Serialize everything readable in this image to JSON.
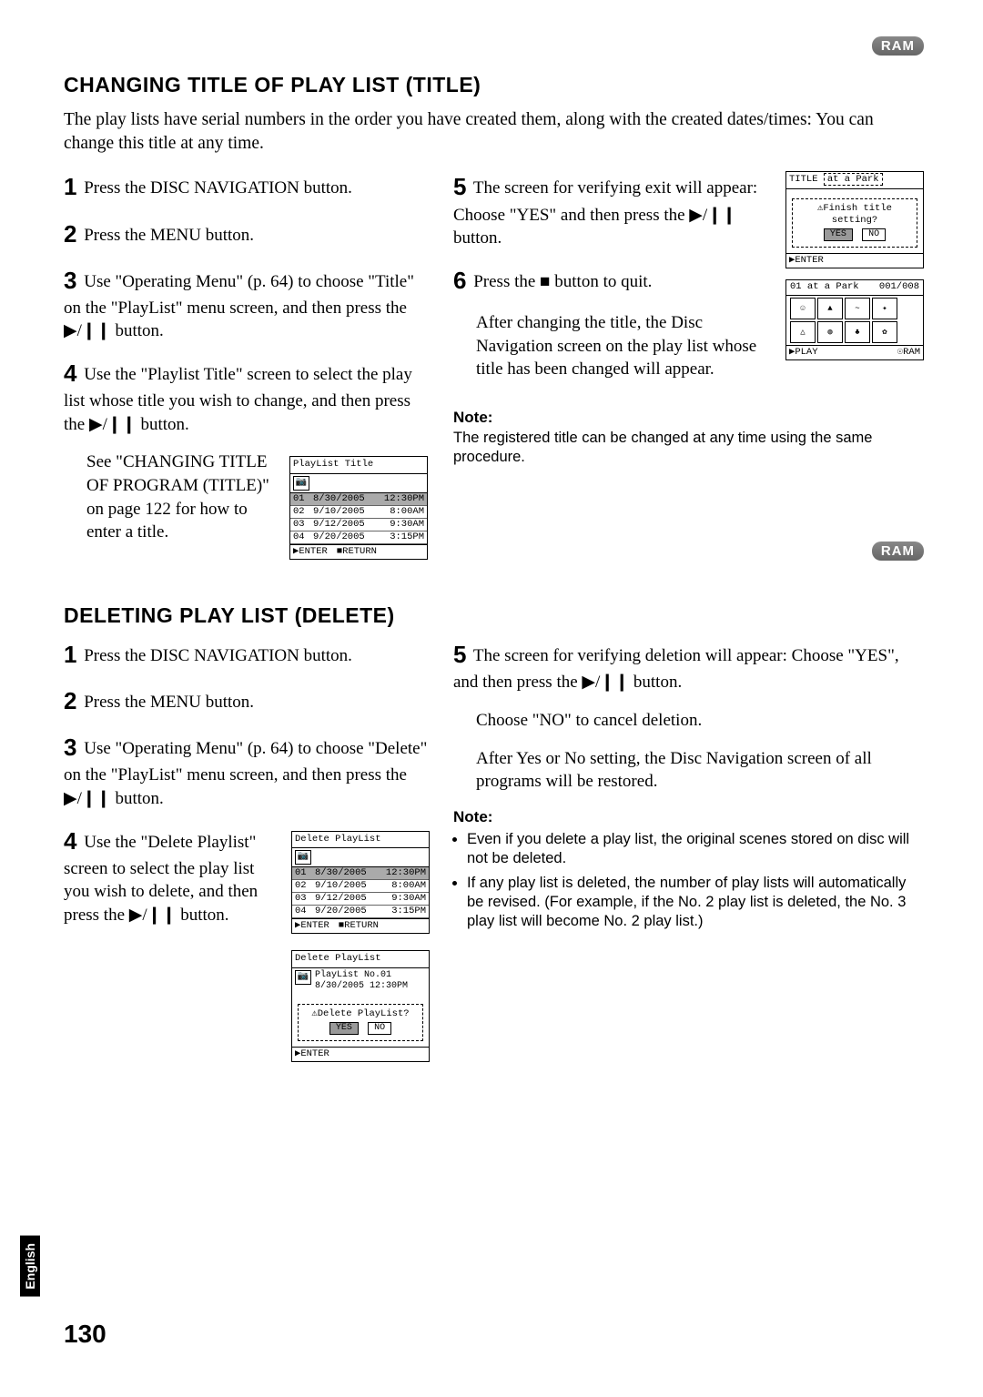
{
  "badges": {
    "ram": "RAM"
  },
  "section1": {
    "heading": "CHANGING TITLE OF PLAY LIST (TITLE)",
    "intro": "The play lists have serial numbers in the order you have created them, along with the created dates/times: You can change this title at any time.",
    "steps_left": {
      "s1": "Press the DISC NAVIGATION button.",
      "s2": "Press the MENU button.",
      "s3": "Use \"Operating Menu\" (p. 64) to choose \"Title\" on the \"PlayList\" menu screen, and then press the ▶/❙❙ button.",
      "s4": "Use the \"Playlist Title\" screen to select the play list whose title you wish to change, and then press the ▶/❙❙ button.",
      "s4_extra": "See \"CHANGING TITLE OF PROGRAM (TITLE)\" on page 122 for how to enter a title."
    },
    "steps_right": {
      "s5": "The screen for verifying exit will appear: Choose \"YES\" and then press the ▶/❙❙ button.",
      "s6": "Press the ■ button to quit.",
      "s6_extra": "After changing the title, the Disc Navigation screen on the play list whose title has been changed will appear."
    },
    "note_label": "Note:",
    "note_body": "The registered title can be changed at any time using the same procedure."
  },
  "section2": {
    "heading": "DELETING PLAY LIST (DELETE)",
    "steps_left": {
      "s1": "Press the DISC NAVIGATION button.",
      "s2": "Press the MENU button.",
      "s3": "Use \"Operating Menu\" (p. 64) to choose \"Delete\" on the \"PlayList\" menu screen, and then press the ▶/❙❙ button.",
      "s4": "Use the \"Delete Playlist\" screen to select the play list you wish to delete, and then press the ▶/❙❙ button."
    },
    "steps_right": {
      "s5": "The screen for verifying deletion will appear: Choose \"YES\", and then press the ▶/❙❙ button.",
      "s5_extra1": "Choose \"NO\" to cancel deletion.",
      "s5_extra2": "After Yes or No setting, the Disc Navigation screen of all programs will be restored."
    },
    "note_label": "Note:",
    "note_bullets": [
      "Even if you delete a play list, the original scenes stored on disc will not be deleted.",
      "If any play list is deleted, the number of play lists will automatically be revised. (For example, if the No. 2 play list is deleted, the No. 3 play list will become No. 2 play list.)"
    ]
  },
  "screenshots": {
    "playlist_title": {
      "header": "PlayList Title",
      "rows": [
        {
          "num": "01",
          "date": "8/30/2005",
          "time": "12:30PM",
          "sel": true
        },
        {
          "num": "02",
          "date": "9/10/2005",
          "time": "8:00AM",
          "sel": false
        },
        {
          "num": "03",
          "date": "9/12/2005",
          "time": "9:30AM",
          "sel": false
        },
        {
          "num": "04",
          "date": "9/20/2005",
          "time": "3:15PM",
          "sel": false
        }
      ],
      "foot_enter": "ENTER",
      "foot_return": "RETURN"
    },
    "title_confirm": {
      "title_label": "TITLE",
      "title_value": "at a Park",
      "prompt": "⚠Finish title setting?",
      "yes": "YES",
      "no": "NO",
      "foot_enter": "ENTER"
    },
    "thumb_nav": {
      "header_left": "01 at a Park",
      "header_right": "001/008",
      "foot_play": "▶PLAY",
      "foot_ram": "☉RAM"
    },
    "delete_playlist": {
      "header": "Delete PlayList",
      "rows": [
        {
          "num": "01",
          "date": "8/30/2005",
          "time": "12:30PM",
          "sel": true
        },
        {
          "num": "02",
          "date": "9/10/2005",
          "time": "8:00AM",
          "sel": false
        },
        {
          "num": "03",
          "date": "9/12/2005",
          "time": "9:30AM",
          "sel": false
        },
        {
          "num": "04",
          "date": "9/20/2005",
          "time": "3:15PM",
          "sel": false
        }
      ],
      "foot_enter": "ENTER",
      "foot_return": "RETURN"
    },
    "delete_confirm": {
      "header": "Delete PlayList",
      "line1": "PlayList No.01",
      "line2": "8/30/2005 12:30PM",
      "prompt": "⚠Delete PlayList?",
      "yes": "YES",
      "no": "NO",
      "foot_enter": "ENTER"
    }
  },
  "side_tab": "English",
  "page_number": "130"
}
